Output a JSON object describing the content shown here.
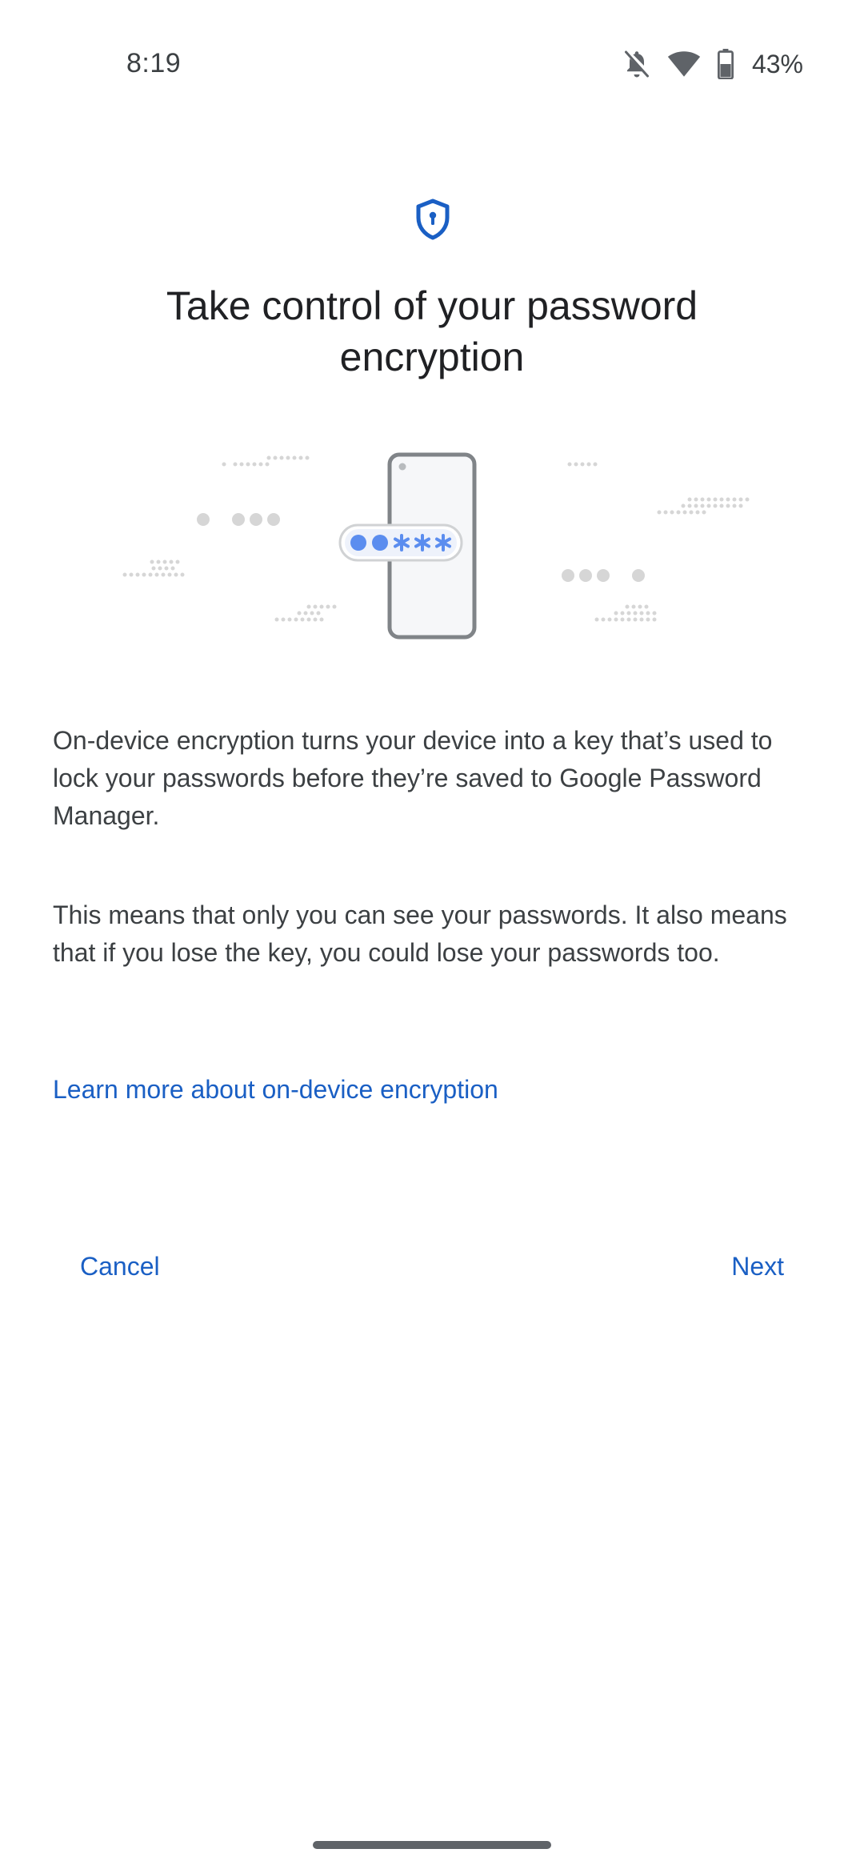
{
  "status_bar": {
    "time": "8:19",
    "icons": [
      "notifications-off-icon",
      "wifi-icon",
      "battery-icon"
    ],
    "battery_percent": "43%"
  },
  "header": {
    "icon": "shield-keyhole-icon",
    "title": "Take control of your password encryption"
  },
  "illustration": {
    "password_mask": "●●✱✱✱"
  },
  "body": {
    "paragraph_1": "On-device encryption turns your device into a key that’s used to lock your passwords before they’re saved to Google Password Manager.",
    "paragraph_2": "This means that only you can see your passwords. It also means that if you lose the key, you could lose your passwords too.",
    "learn_more_link": "Learn more about on-device encryption"
  },
  "actions": {
    "cancel_label": "Cancel",
    "next_label": "Next"
  },
  "colors": {
    "accent": "#1a5fc4",
    "illustration_blue": "#5b8def",
    "text_primary": "#202124",
    "text_secondary": "#3c4043"
  }
}
